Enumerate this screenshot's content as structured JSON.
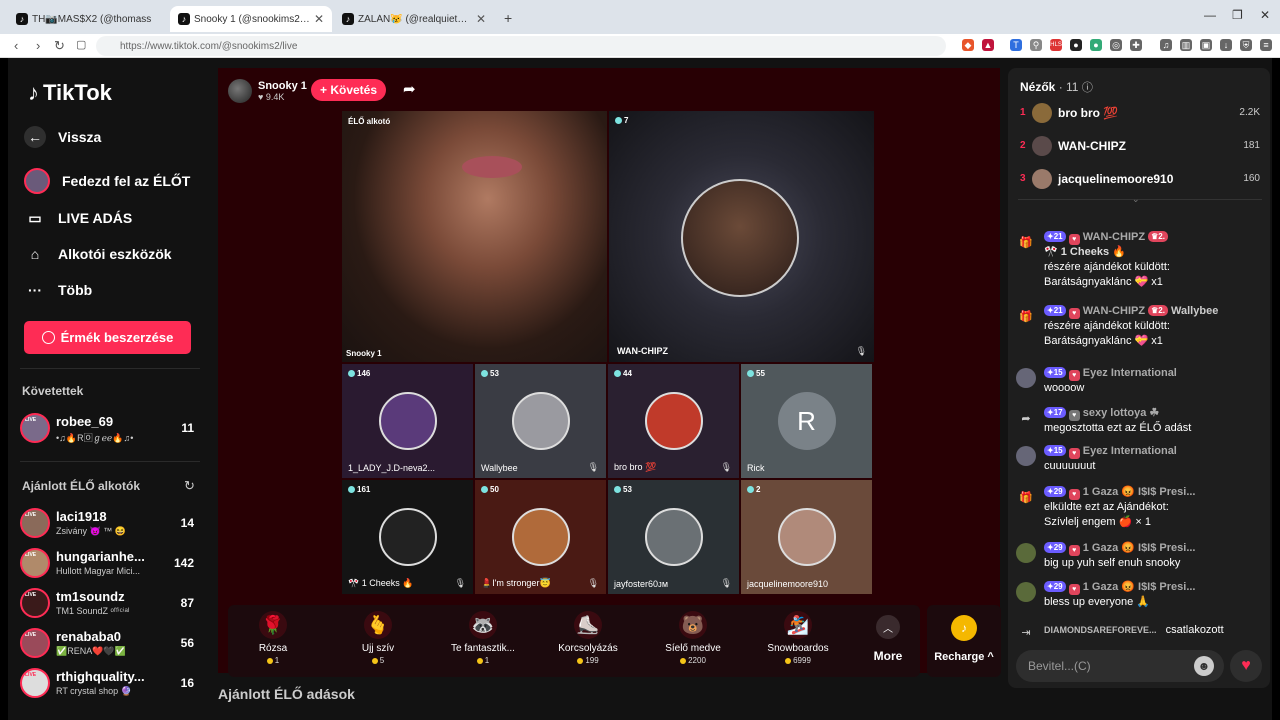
{
  "browser": {
    "tabs": [
      {
        "label": "TH📷MAS$X2 (@thomass"
      },
      {
        "label": "Snooky 1 (@snookims2) ÉLŐ"
      },
      {
        "label": "ZALÁN😿 (@realquietalpha) ÉLŐ"
      }
    ],
    "url": "https://www.tiktok.com/@snookims2/live",
    "new_tab": "+"
  },
  "sidebar": {
    "logo": "TikTok",
    "nav": [
      {
        "label": "Vissza",
        "icon": "back-arrow-icon"
      },
      {
        "label": "Fedezd fel az ÉLŐT",
        "icon": "explore-live-icon"
      },
      {
        "label": "LIVE ADÁS",
        "icon": "camera-icon"
      },
      {
        "label": "Alkotói eszközök",
        "icon": "creator-tools-icon"
      },
      {
        "label": "Több",
        "icon": "more-icon"
      }
    ],
    "coins_button": "Érmék beszerzése",
    "following_title": "Követettek",
    "following": [
      {
        "name": "robee_69",
        "sub": "•♫🔥R🄾ℊℯℯ🔥♫•",
        "count": "11"
      }
    ],
    "recommended_title": "Ajánlott ÉLŐ alkotók",
    "recommended": [
      {
        "name": "laci1918",
        "sub": "Zsivány 😈 ™ 😆",
        "count": "14"
      },
      {
        "name": "hungarianhe...",
        "sub": "Hullott Magyar Mici...",
        "count": "142"
      },
      {
        "name": "tm1soundz",
        "sub": "TM1 SoundZ ᵒᶠᶠⁱᶜⁱᵃˡ",
        "count": "87"
      },
      {
        "name": "renababa0",
        "sub": "✅RENA❤️🖤✅",
        "count": "56"
      },
      {
        "name": "rthighquality...",
        "sub": "RT crystal shop 🔮",
        "count": "16"
      }
    ],
    "live_badge": "LIVE"
  },
  "host": {
    "name": "Snooky 1",
    "likes": "9.4K",
    "follow_label": "+ Követés"
  },
  "grid": {
    "main": {
      "tag": "ÉLŐ alkotó",
      "name": "Snooky 1"
    },
    "guest_big": {
      "count": "7",
      "name": "WAN-CHIPZ"
    },
    "cells": [
      {
        "count": "146",
        "name": "1_LADY_J.D-neva2..."
      },
      {
        "count": "53",
        "name": "Wallybee"
      },
      {
        "count": "44",
        "name": "bro bro 💯"
      },
      {
        "count": "55",
        "name": "Rick",
        "initial": "R"
      },
      {
        "count": "161",
        "name": "🎌 1 Cheeks 🔥"
      },
      {
        "count": "50",
        "name": "💄I'm stronger😇"
      },
      {
        "count": "53",
        "name": "jayfoster60ᴊᴍ"
      },
      {
        "count": "2",
        "name": "jacquelinemoore910"
      }
    ]
  },
  "gifts": [
    {
      "name": "Rózsa",
      "price": "1",
      "icon": "🌹",
      "bg": "#3a0a10"
    },
    {
      "name": "Ujj szív",
      "price": "5",
      "icon": "🫰",
      "bg": "#3a0a10"
    },
    {
      "name": "Te fantasztik...",
      "price": "1",
      "icon": "🦝",
      "bg": "#3a0a10"
    },
    {
      "name": "Korcsolyázás",
      "price": "199",
      "icon": "⛸️",
      "bg": "#3a0a10"
    },
    {
      "name": "Síelő medve",
      "price": "2200",
      "icon": "🐻",
      "bg": "#3a0a10"
    },
    {
      "name": "Snowboardos",
      "price": "6999",
      "icon": "🏂",
      "bg": "#3a0a10"
    }
  ],
  "more_label": "More",
  "recharge_label": "Recharge ^",
  "bottom_title": "Ajánlott ÉLŐ adások",
  "chat": {
    "viewers_label": "Nézők",
    "viewers_count": "· 11",
    "top_viewers": [
      {
        "rank": "1",
        "name": "bro bro 💯",
        "count": "2.2K"
      },
      {
        "rank": "2",
        "name": "WAN-CHIPZ",
        "count": "181"
      },
      {
        "rank": "3",
        "name": "jacquelinemoore910",
        "count": "160"
      }
    ],
    "messages": [
      {
        "lvl": "21",
        "user": "WAN-CHIPZ",
        "badge2": "2.",
        "line1": "🎌 1 Cheeks 🔥",
        "line2": "részére ajándékot küldött:",
        "line3": "Barátságnyaklánc 💝 x1",
        "icon": "gift-icon"
      },
      {
        "lvl": "21",
        "user": "WAN-CHIPZ",
        "badge2": "2.",
        "extra": "Wallybee",
        "line2": "részére ajándékot küldött:",
        "line3": "Barátságnyaklánc 💝 x1",
        "icon": "gift-icon"
      },
      {
        "lvl": "15",
        "user": "Eyez International",
        "line2": "woooow",
        "icon": "avatar"
      },
      {
        "lvl": "17",
        "user": "sexy lottoya ☘",
        "line2": "megosztotta ezt az ÉLŐ adást",
        "icon": "share-icon"
      },
      {
        "lvl": "15",
        "user": "Eyez International",
        "line2": "cuuuuuuut",
        "icon": "avatar"
      },
      {
        "lvl": "29",
        "user": "1 Gaza 😡 I$I$ Presi...",
        "line2": "elküldte ezt az Ajándékot:",
        "line3": "Szívlelj engem 🍎 × 1",
        "icon": "gift-icon"
      },
      {
        "lvl": "29",
        "user": "1 Gaza 😡 I$I$ Presi...",
        "line2": "big up yuh self enuh snooky",
        "icon": "avatar"
      },
      {
        "lvl": "29",
        "user": "1 Gaza 😡 I$I$ Presi...",
        "line2": "bless up everyone 🙏",
        "icon": "avatar"
      },
      {
        "user": "DIAMONDSAREFOREVE...",
        "line2": "csatlakozott",
        "icon": "join-icon"
      }
    ],
    "input_placeholder": "Bevitel...(C)"
  }
}
